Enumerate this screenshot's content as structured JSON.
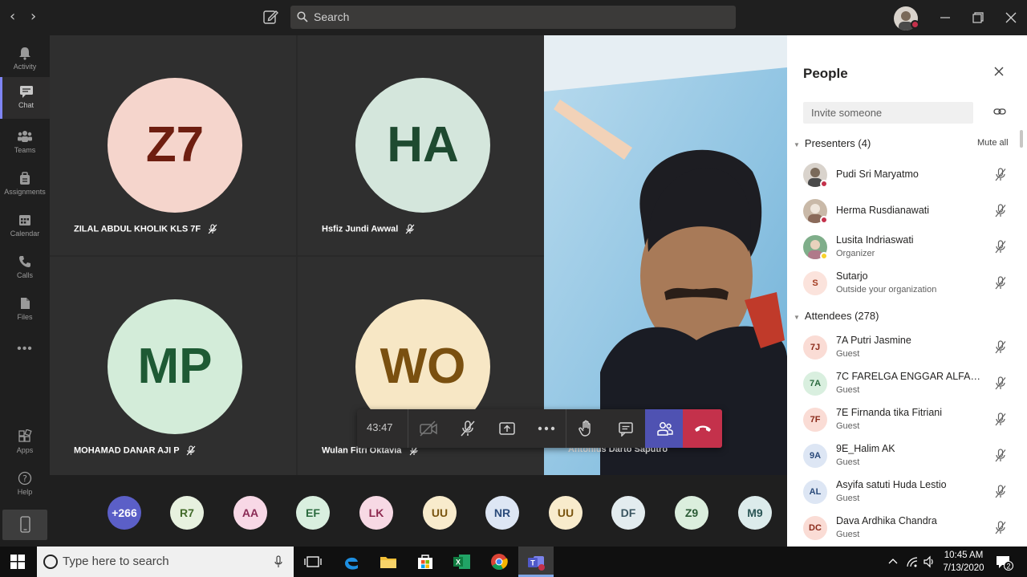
{
  "titlebar": {
    "search_placeholder": "Search",
    "back": "‹",
    "forward": "›"
  },
  "rail": [
    {
      "label": "Activity",
      "icon": "bell-icon"
    },
    {
      "label": "Chat",
      "icon": "chat-icon",
      "active": true
    },
    {
      "label": "Teams",
      "icon": "teams-icon"
    },
    {
      "label": "Assignments",
      "icon": "assignments-icon"
    },
    {
      "label": "Calendar",
      "icon": "calendar-icon"
    },
    {
      "label": "Calls",
      "icon": "phone-icon"
    },
    {
      "label": "Files",
      "icon": "files-icon"
    },
    {
      "label": "Apps",
      "icon": "apps-icon"
    },
    {
      "label": "Help",
      "icon": "help-icon"
    }
  ],
  "rail_more": "•••",
  "tiles": [
    {
      "initials": "Z7",
      "name": "ZILAL ABDUL KHOLIK KLS 7F",
      "bg": "#f5d5cc",
      "fg": "#6e1e10"
    },
    {
      "initials": "HA",
      "name": "Hsfiz Jundi Awwal",
      "bg": "#d4e6dc",
      "fg": "#1e4a30"
    },
    {
      "initials": "MP",
      "name": "MOHAMAD DANAR AJI P",
      "bg": "#d3ecd9",
      "fg": "#1e5a34"
    },
    {
      "initials": "WO",
      "name": "Wulan Fitri Oktavia",
      "bg": "#f7e7c5",
      "fg": "#7a5010"
    }
  ],
  "video": {
    "name": "Antonius Darto Saputro"
  },
  "call_bar": {
    "timer": "43:47"
  },
  "gallery": [
    {
      "label": "+266",
      "bg": "#5b5fc7",
      "fg": "#ffffff"
    },
    {
      "label": "R7",
      "bg": "#e7f1df",
      "fg": "#426a2a"
    },
    {
      "label": "AA",
      "bg": "#f8d8e6",
      "fg": "#8a2a55"
    },
    {
      "label": "EF",
      "bg": "#d9efdf",
      "fg": "#2a6a3e"
    },
    {
      "label": "LK",
      "bg": "#f7d9e4",
      "fg": "#8e2a50"
    },
    {
      "label": "UU",
      "bg": "#f8ebcc",
      "fg": "#7a5510"
    },
    {
      "label": "NR",
      "bg": "#dde6f4",
      "fg": "#2a4a7a"
    },
    {
      "label": "UU",
      "bg": "#f8ebcc",
      "fg": "#7a5510"
    },
    {
      "label": "DF",
      "bg": "#e3ecef",
      "fg": "#3a5560"
    },
    {
      "label": "Z9",
      "bg": "#dbeedd",
      "fg": "#2a5a34"
    },
    {
      "label": "M9",
      "bg": "#dcebeb",
      "fg": "#2a5555"
    }
  ],
  "people_panel": {
    "title": "People",
    "invite_placeholder": "Invite someone",
    "mute_all": "Mute all",
    "presenters_label": "Presenters (4)",
    "attendees_label": "Attendees (278)",
    "presenters": [
      {
        "name": "Pudi Sri Maryatmo",
        "role": "",
        "initials": "",
        "bg": "#d9d3cc",
        "status": "#c4314b"
      },
      {
        "name": "Herma Rusdianawati",
        "role": "",
        "initials": "",
        "bg": "#c9b9a8",
        "status": "#c4314b"
      },
      {
        "name": "Lusita Indriaswati",
        "role": "Organizer",
        "initials": "",
        "bg": "#7fae8a",
        "status": "#f8d22a"
      },
      {
        "name": "Sutarjo",
        "role": "Outside your organization",
        "initials": "S",
        "bg": "#fbe3dc",
        "fg": "#a33a1f",
        "status": ""
      }
    ],
    "attendees": [
      {
        "name": "7A Putri Jasmine",
        "role": "Guest",
        "initials": "7J",
        "bg": "#fadcd5",
        "fg": "#8a2a1a"
      },
      {
        "name": "7C FARELGA ENGGAR ALFAR...",
        "role": "Guest",
        "initials": "7A",
        "bg": "#d9efdf",
        "fg": "#2a6a3e"
      },
      {
        "name": "7E Firnanda tika Fitriani",
        "role": "Guest",
        "initials": "7F",
        "bg": "#fadcd5",
        "fg": "#8a2a1a"
      },
      {
        "name": "9E_Halim AK",
        "role": "Guest",
        "initials": "9A",
        "bg": "#dde6f4",
        "fg": "#2a4a7a"
      },
      {
        "name": "Asyifa satuti Huda Lestio",
        "role": "Guest",
        "initials": "AL",
        "bg": "#dde6f4",
        "fg": "#2a4a7a"
      },
      {
        "name": "Dava Ardhika Chandra",
        "role": "Guest",
        "initials": "DC",
        "bg": "#fadcd5",
        "fg": "#8a2a1a"
      }
    ]
  },
  "taskbar": {
    "search_placeholder": "Type here to search",
    "time": "10:45 AM",
    "date": "7/13/2020",
    "notif_count": "2"
  }
}
